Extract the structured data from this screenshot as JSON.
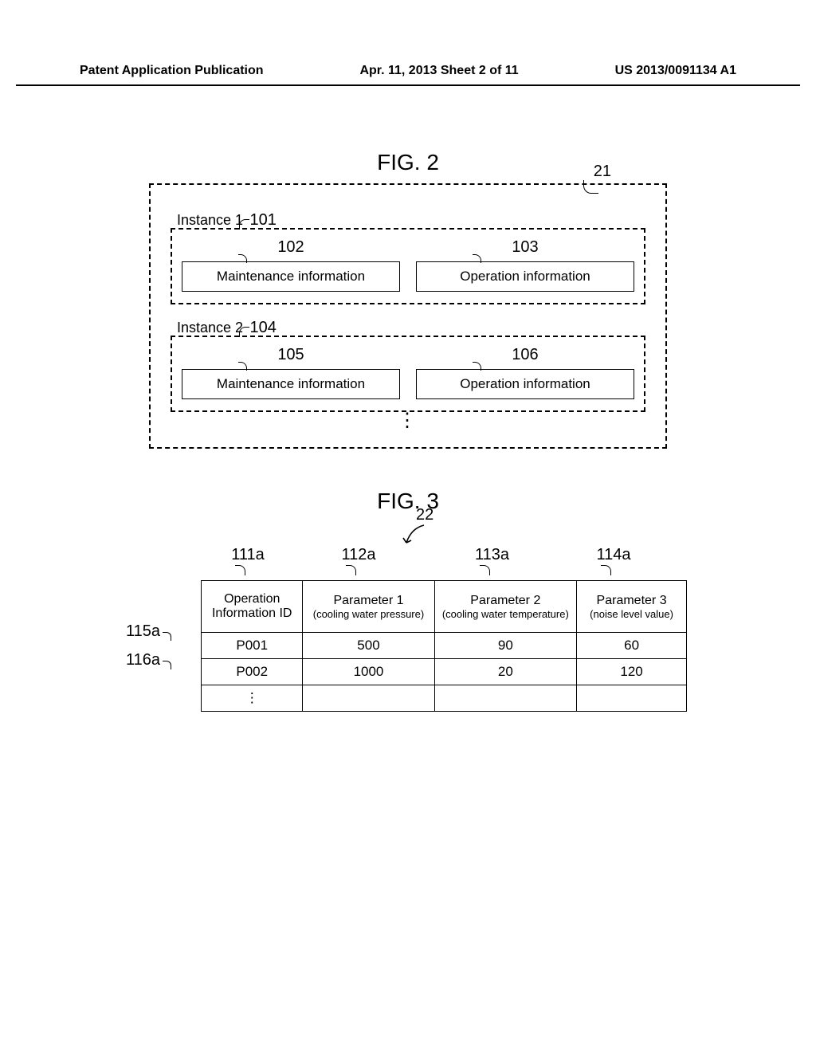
{
  "header": {
    "left": "Patent Application Publication",
    "center": "Apr. 11, 2013  Sheet 2 of 11",
    "right": "US 2013/0091134 A1"
  },
  "fig2": {
    "title": "FIG. 2",
    "ref_outer": "21",
    "instance1": {
      "label": "Instance 1",
      "ref": "101",
      "maintenance": {
        "label": "Maintenance information",
        "ref": "102"
      },
      "operation": {
        "label": "Operation information",
        "ref": "103"
      }
    },
    "instance2": {
      "label": "Instance 2",
      "ref": "104",
      "maintenance": {
        "label": "Maintenance information",
        "ref": "105"
      },
      "operation": {
        "label": "Operation information",
        "ref": "106"
      }
    }
  },
  "fig3": {
    "title": "FIG. 3",
    "ref_table": "22",
    "columns": [
      {
        "ref": "111a",
        "header": "Operation Information ID",
        "sub": ""
      },
      {
        "ref": "112a",
        "header": "Parameter 1",
        "sub": "(cooling water pressure)"
      },
      {
        "ref": "113a",
        "header": "Parameter 2",
        "sub": "(cooling water temperature)"
      },
      {
        "ref": "114a",
        "header": "Parameter 3",
        "sub": "(noise level value)"
      }
    ],
    "rows": [
      {
        "ref": "115a",
        "id": "P001",
        "p1": "500",
        "p2": "90",
        "p3": "60"
      },
      {
        "ref": "116a",
        "id": "P002",
        "p1": "1000",
        "p2": "20",
        "p3": "120"
      }
    ]
  }
}
